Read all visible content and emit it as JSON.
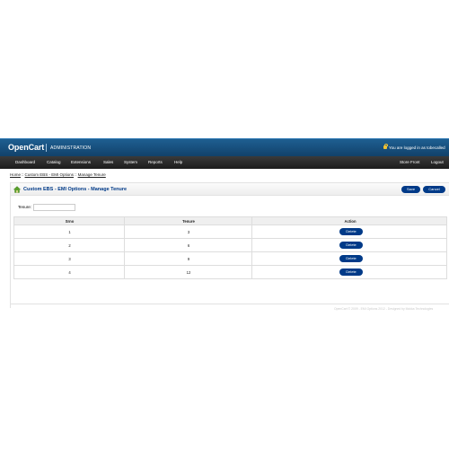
{
  "header": {
    "logo": "OpenCart",
    "admin_label": "ADMINISTRATION",
    "logged_in_text": "You are logged in as tobecalled"
  },
  "menu": {
    "left": [
      "Dashboard",
      "Catalog",
      "Extensions",
      "Sales",
      "System",
      "Reports",
      "Help"
    ],
    "right": [
      "Store Front",
      "Logout"
    ]
  },
  "breadcrumb": {
    "items": [
      "Home",
      "Custom EBS - EMI Options",
      "Manage Tenure"
    ],
    "separator": "::"
  },
  "page": {
    "title": "Custom EBS - EMI Options - Manage Tenure",
    "save_label": "Save",
    "cancel_label": "Cancel",
    "tenure_label": "Tenure:",
    "tenure_value": ""
  },
  "table": {
    "columns": [
      "Srno",
      "Tenure",
      "Action"
    ],
    "rows": [
      {
        "srno": "1",
        "tenure": "3",
        "action": "Delete"
      },
      {
        "srno": "2",
        "tenure": "6",
        "action": "Delete"
      },
      {
        "srno": "3",
        "tenure": "9",
        "action": "Delete"
      },
      {
        "srno": "4",
        "tenure": "12",
        "action": "Delete"
      }
    ]
  },
  "footer": {
    "text": "OpenCart © 2009 - EMI Options 2012 - Designed by Mokka Technologies"
  },
  "colors": {
    "header_blue": "#1e5f91",
    "menu_dark": "#1c1c1c",
    "button_blue": "#003a88",
    "title_blue": "#003a88"
  }
}
